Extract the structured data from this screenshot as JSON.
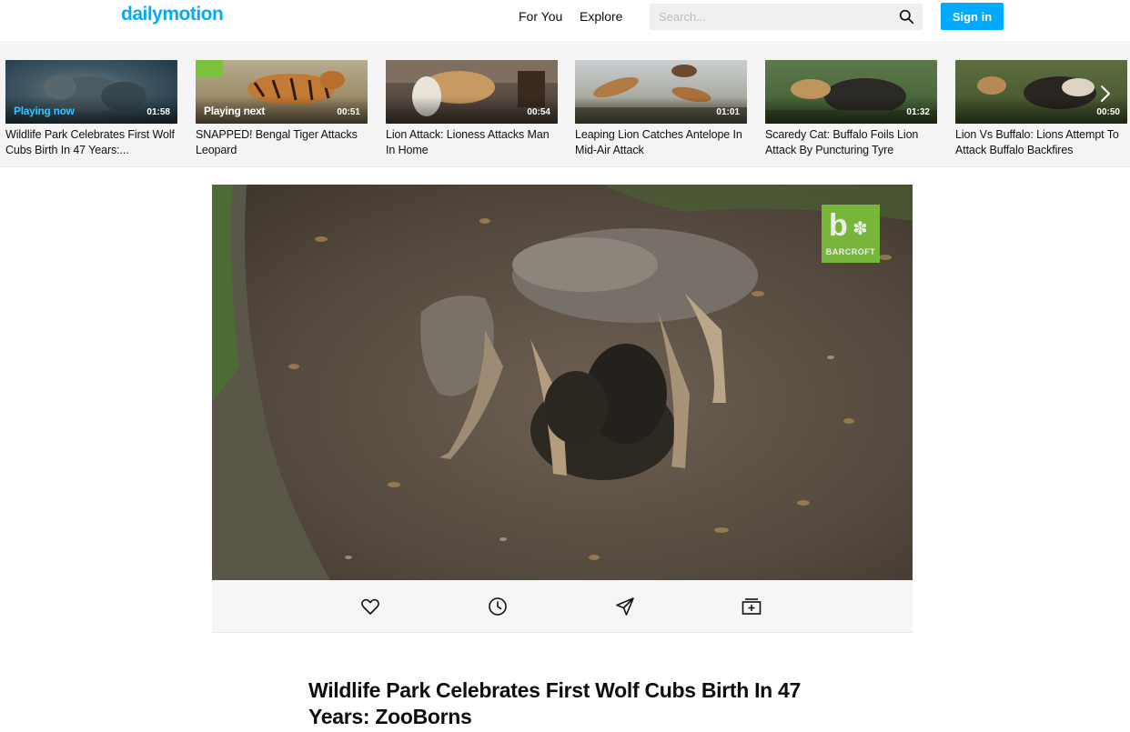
{
  "header": {
    "logo": "dailymotion",
    "nav": [
      "For You",
      "Explore"
    ],
    "search_placeholder": "Search...",
    "signin_label": "Sign in"
  },
  "playlist": [
    {
      "tag": "Playing now",
      "duration": "01:58",
      "title": "Wildlife Park Celebrates First Wolf Cubs Birth In 47 Years:..."
    },
    {
      "tag": "Playing next",
      "duration": "00:51",
      "title": "SNAPPED! Bengal Tiger Attacks Leopard"
    },
    {
      "tag": "",
      "duration": "00:54",
      "title": "Lion Attack: Lioness Attacks Man In Home"
    },
    {
      "tag": "",
      "duration": "01:01",
      "title": "Leaping Lion Catches Antelope In Mid-Air Attack"
    },
    {
      "tag": "",
      "duration": "01:32",
      "title": "Scaredy Cat: Buffalo Foils Lion Attack By Puncturing Tyre"
    },
    {
      "tag": "",
      "duration": "00:50",
      "title": "Lion Vs Buffalo: Lions Attempt To Attack Buffalo Backfires"
    }
  ],
  "player": {
    "watermark": "BARCROFT"
  },
  "actions": [
    "heart-icon",
    "clock-icon",
    "send-icon",
    "add-to-playlist-icon"
  ],
  "video": {
    "title": "Wildlife Park Celebrates First Wolf Cubs Birth In 47 Years: ZooBorns"
  },
  "colors": {
    "brand": "#00aaff",
    "playing_now": "#33c3ff",
    "watermark": "#7cc23c"
  }
}
